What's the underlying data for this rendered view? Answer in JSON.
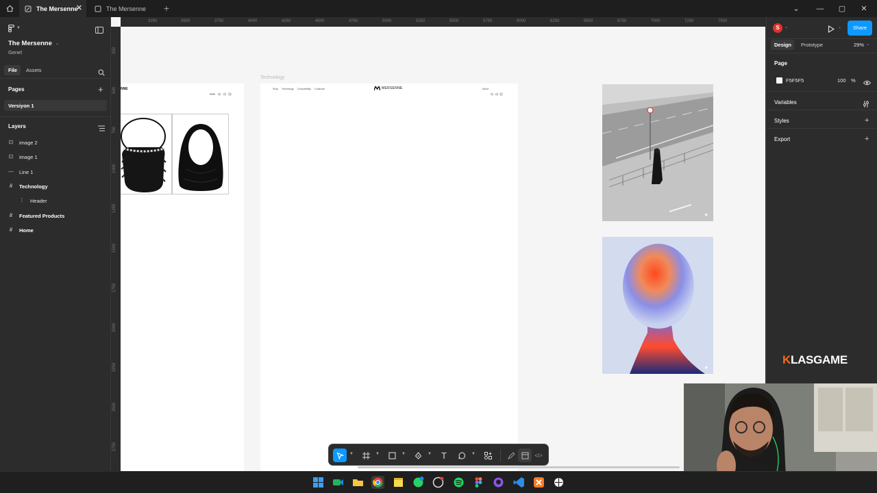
{
  "tabs": [
    {
      "label": "The Mersenne",
      "active": true
    },
    {
      "label": "The Mersenne",
      "active": false
    }
  ],
  "left_panel": {
    "project_title": "The Mersenne",
    "project_subtitle": "Genel",
    "tab_file": "File",
    "tab_assets": "Assets",
    "pages_heading": "Pages",
    "pages": [
      "Versiyon 1"
    ],
    "layers_heading": "Layers",
    "layers": [
      {
        "label": "image 2",
        "icon": "image-icon",
        "bold": false,
        "indent": 0
      },
      {
        "label": "image 1",
        "icon": "image-icon",
        "bold": false,
        "indent": 0
      },
      {
        "label": "Line 1",
        "icon": "line-icon",
        "bold": false,
        "indent": 0
      },
      {
        "label": "Technology",
        "icon": "frame-icon",
        "bold": true,
        "indent": 0
      },
      {
        "label": "Header",
        "icon": "group-icon",
        "bold": false,
        "indent": 1
      },
      {
        "label": "Featured Products",
        "icon": "frame-icon",
        "bold": true,
        "indent": 0
      },
      {
        "label": "Home",
        "icon": "frame-icon",
        "bold": true,
        "indent": 0
      }
    ]
  },
  "ruler": {
    "top": [
      "3250",
      "3500",
      "3750",
      "4000",
      "4250",
      "4500",
      "4750",
      "5000",
      "5250",
      "5500",
      "5750",
      "6000",
      "6250",
      "6500",
      "6750",
      "7000",
      "7250",
      "7500"
    ],
    "left": [
      "250",
      "500",
      "750",
      "1000",
      "1250",
      "1500",
      "1750",
      "2000",
      "2250",
      "2500",
      "2750"
    ]
  },
  "canvas": {
    "frame_label": "Technology",
    "brand": "MERSENNE",
    "brand_partial": "NNE",
    "nav_items": [
      "Shop",
      "Technology",
      "Compatibility",
      "Lookbook"
    ],
    "nav_right": "About"
  },
  "right_panel": {
    "avatar_letter": "S",
    "share_label": "Share",
    "tab_design": "Design",
    "tab_prototype": "Prototype",
    "zoom": "29%",
    "page_heading": "Page",
    "page_color": "F5F5F5",
    "page_opacity": "100",
    "percent": "%",
    "variables": "Variables",
    "styles": "Styles",
    "export": "Export"
  },
  "overlay": {
    "watermark_k": "K",
    "watermark_rest": "LASGAME"
  }
}
